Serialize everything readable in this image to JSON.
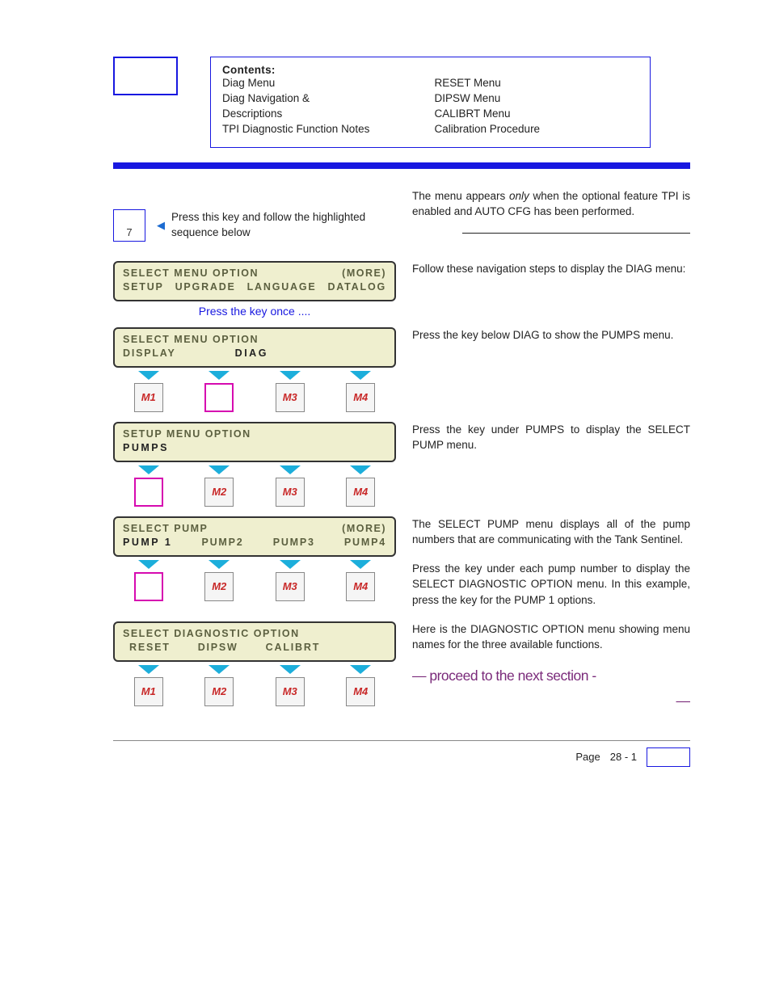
{
  "contents": {
    "heading": "Contents:",
    "left": [
      "Diag Menu",
      "Diag Navigation &",
      "Descriptions",
      "TPI Diagnostic Function Notes"
    ],
    "right": [
      "RESET Menu",
      "DIPSW Menu",
      "CALIBRT Menu",
      "Calibration Procedure"
    ]
  },
  "intro": {
    "p1a": "The ",
    "p1b": " menu appears ",
    "p1c": "only",
    "p1d": " when the optional feature TPI is enabled and AUTO CFG has been performed."
  },
  "key7": {
    "num": "7",
    "instr": "Press this key and follow the highlighted sequence below"
  },
  "press_down": {
    "a": "Press the ",
    "b": " key once ...."
  },
  "lcd1": {
    "title": "SELECT MENU OPTION",
    "more": "(MORE)",
    "opts": [
      "SETUP",
      "UPGRADE",
      "LANGUAGE",
      "DATALOG"
    ]
  },
  "lcd2": {
    "title": "SELECT  MENU  OPTION",
    "opts": [
      "DISPLAY",
      "DIAG"
    ]
  },
  "lcd3": {
    "title": "SETUP MENU OPTION",
    "opts": [
      "PUMPS"
    ]
  },
  "lcd4": {
    "title": "SELECT PUMP",
    "more": "(MORE)",
    "opts": [
      "PUMP 1",
      "PUMP2",
      "PUMP3",
      "PUMP4"
    ]
  },
  "lcd5": {
    "title": "SELECT DIAGNOSTIC OPTION",
    "opts": [
      "RESET",
      "DIPSW",
      "CALIBRT"
    ]
  },
  "mkeys": {
    "m1": "M1",
    "m2": "M2",
    "m3": "M3",
    "m4": "M4"
  },
  "para": {
    "nav": "Follow these navigation steps to display the DIAG menu:",
    "p2a": "Press the ",
    "p2b": " key below DIAG to show the PUMPS menu.",
    "p3a": "Press the ",
    "p3b": " key under PUMPS to display the SELECT PUMP menu.",
    "p4": "The SELECT PUMP menu displays all of the pump numbers that are communicating with the Tank Sentinel.",
    "p5a": "Press the ",
    "p5b": " key under each pump number to display the SELECT DIAGNOSTIC OPTION menu. In this example, press the ",
    "p5c": " key for the PUMP 1 options.",
    "p6": "Here is the DIAGNOSTIC OPTION menu showing menu names for the three available functions."
  },
  "proceed": "— proceed to the next section -",
  "proceed_dash": "—",
  "footer": {
    "page_label": "Page",
    "page_num": "28 - 1"
  }
}
